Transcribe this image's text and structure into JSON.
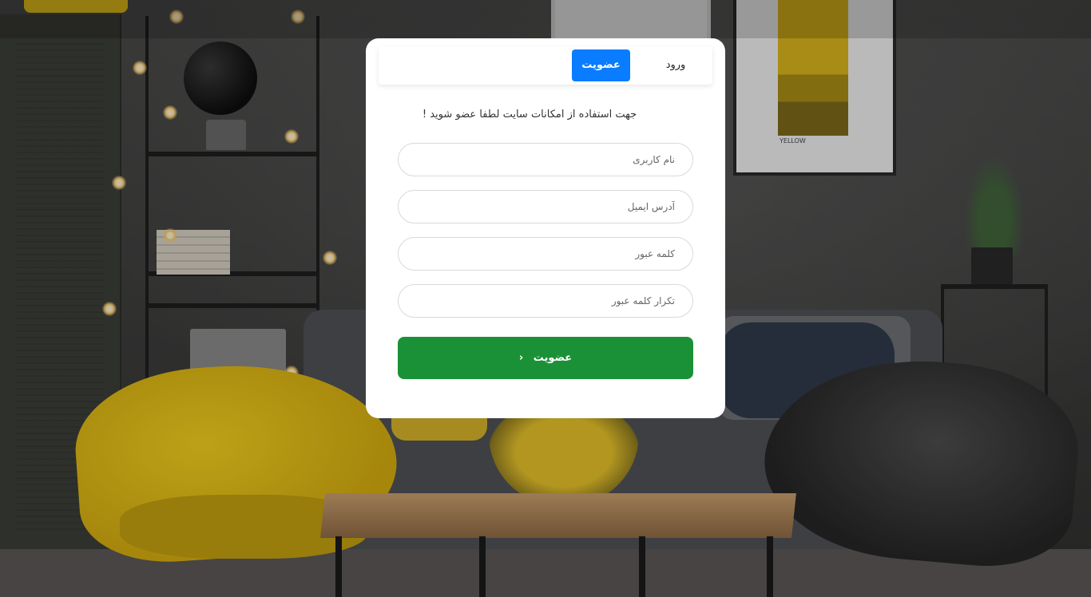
{
  "tabs": {
    "login_label": "ورود",
    "register_label": "عضویت",
    "active": "register"
  },
  "form": {
    "subtitle": "جهت استفاده از امکانات سایت لطفا عضو شوید !",
    "username_placeholder": "نام کاربری",
    "email_placeholder": "آدرس ایمیل",
    "password_placeholder": "کلمه عبور",
    "password_repeat_placeholder": "تکرار کلمه عبور",
    "submit_label": "عضویت",
    "submit_icon": "chevron-left-icon"
  },
  "background": {
    "poster_caption": "YELLOW"
  },
  "colors": {
    "accent_blue": "#0a7cff",
    "submit_green": "#1b9137"
  }
}
